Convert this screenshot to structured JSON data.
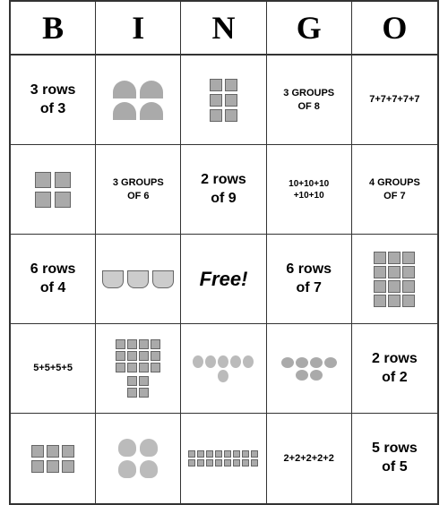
{
  "header": {
    "letters": [
      "B",
      "I",
      "N",
      "G",
      "O"
    ]
  },
  "cells": [
    {
      "id": "r0c0",
      "type": "text",
      "text": "3 rows\nof 3"
    },
    {
      "id": "r0c1",
      "type": "watermelons",
      "count": 4
    },
    {
      "id": "r0c2",
      "type": "squares_grid",
      "cols": 2,
      "rows": 3
    },
    {
      "id": "r0c3",
      "type": "text",
      "text": "3 GROUPS OF 8",
      "size": "small"
    },
    {
      "id": "r0c4",
      "type": "text",
      "text": "7+7+7+7+7",
      "size": "small"
    },
    {
      "id": "r1c0",
      "type": "squares_2x2"
    },
    {
      "id": "r1c1",
      "type": "text",
      "text": "3 GROUPS OF 6",
      "size": "small"
    },
    {
      "id": "r1c2",
      "type": "text",
      "text": "2 rows\nof 9"
    },
    {
      "id": "r1c3",
      "type": "text",
      "text": "10+10+10+10+10",
      "size": "tiny"
    },
    {
      "id": "r1c4",
      "type": "text",
      "text": "4 GROUPS OF 7",
      "size": "small"
    },
    {
      "id": "r2c0",
      "type": "text",
      "text": "6 rows\nof 4"
    },
    {
      "id": "r2c1",
      "type": "baskets"
    },
    {
      "id": "r2c2",
      "type": "free"
    },
    {
      "id": "r2c3",
      "type": "text",
      "text": "6 rows\nof 7"
    },
    {
      "id": "r2c4",
      "type": "squares_grid",
      "cols": 3,
      "rows": 4
    },
    {
      "id": "r3c0",
      "type": "text",
      "text": "5+5+5+5",
      "size": "small"
    },
    {
      "id": "r3c1",
      "type": "squares_grid2"
    },
    {
      "id": "r3c2",
      "type": "balloons"
    },
    {
      "id": "r3c3",
      "type": "ladybugs"
    },
    {
      "id": "r3c4",
      "type": "text",
      "text": "2 rows\nof 2"
    },
    {
      "id": "r4c0",
      "type": "squares_2x3"
    },
    {
      "id": "r4c1",
      "type": "bears"
    },
    {
      "id": "r4c2",
      "type": "dots_many"
    },
    {
      "id": "r4c3",
      "type": "text",
      "text": "2+2+2+2+2",
      "size": "small"
    },
    {
      "id": "r4c4",
      "type": "text",
      "text": "5 rows\nof 5"
    }
  ]
}
